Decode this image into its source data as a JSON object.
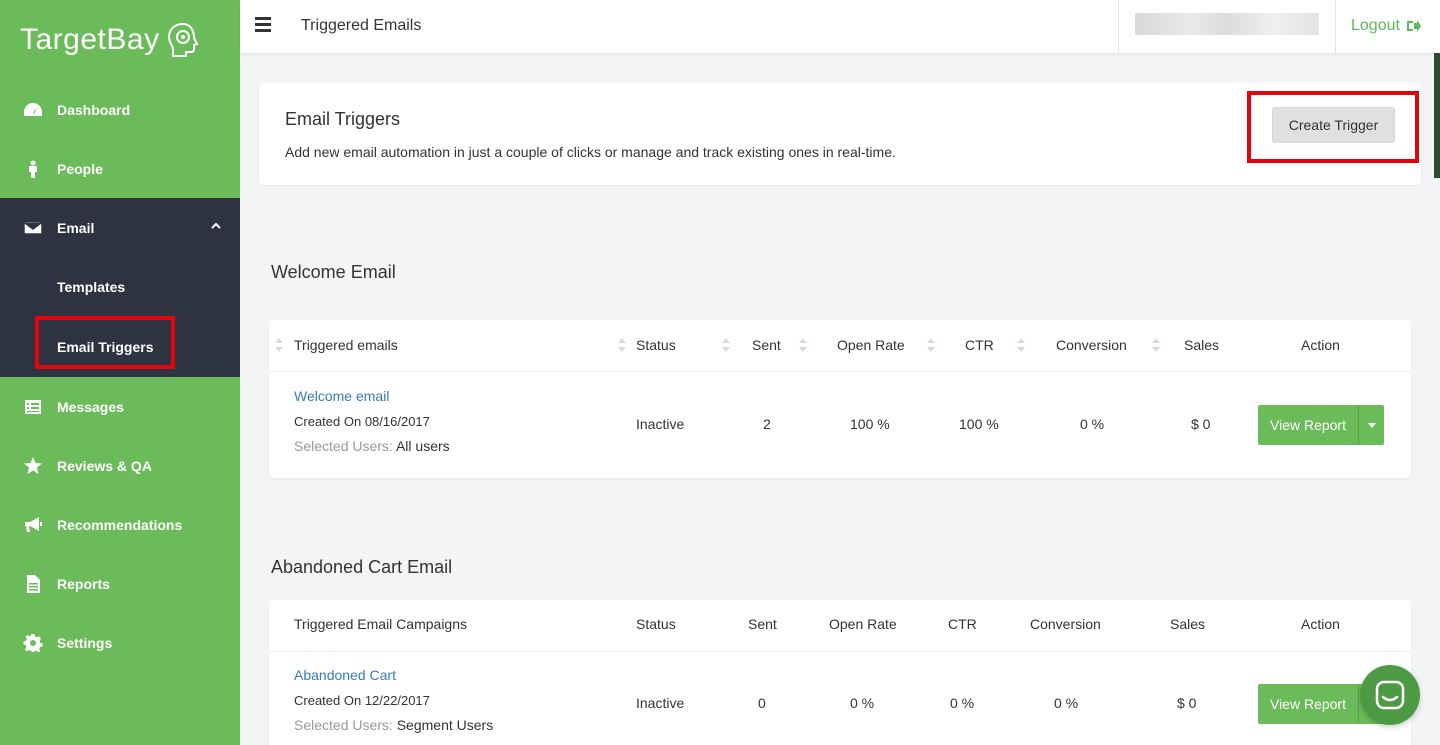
{
  "brand": {
    "name": "TargetBay"
  },
  "sidebar": {
    "items": [
      {
        "label": "Dashboard",
        "icon": "dashboard-icon"
      },
      {
        "label": "People",
        "icon": "person-icon"
      },
      {
        "label": "Email",
        "icon": "envelope-icon"
      },
      {
        "label": "Templates"
      },
      {
        "label": "Email Triggers"
      },
      {
        "label": "Messages",
        "icon": "messages-icon"
      },
      {
        "label": "Reviews & QA",
        "icon": "star-icon"
      },
      {
        "label": "Recommendations",
        "icon": "megaphone-icon"
      },
      {
        "label": "Reports",
        "icon": "document-icon"
      },
      {
        "label": "Settings",
        "icon": "gear-icon"
      }
    ]
  },
  "topbar": {
    "title": "Triggered Emails",
    "logout_label": "Logout"
  },
  "trigger_card": {
    "title": "Email Triggers",
    "description": "Add new email automation in just a couple of clicks or manage and track existing ones in real-time.",
    "create_label": "Create Trigger"
  },
  "welcome": {
    "section_title": "Welcome Email",
    "headers": [
      "Triggered emails",
      "Status",
      "Sent",
      "Open Rate",
      "CTR",
      "Conversion",
      "Sales",
      "Action"
    ],
    "row": {
      "name": "Welcome email",
      "created": "Created On 08/16/2017",
      "users_label": "Selected Users:",
      "users_value": "All users",
      "status": "Inactive",
      "sent": "2",
      "open_rate": "100 %",
      "ctr": "100 %",
      "conversion": "0 %",
      "sales": "$ 0",
      "action_label": "View Report"
    }
  },
  "abandoned": {
    "section_title": "Abandoned Cart Email",
    "headers": [
      "Triggered Email Campaigns",
      "Status",
      "Sent",
      "Open Rate",
      "CTR",
      "Conversion",
      "Sales",
      "Action"
    ],
    "row": {
      "name": "Abandoned Cart",
      "created": "Created On 12/22/2017",
      "users_label": "Selected Users:",
      "users_value": "Segment Users",
      "status": "Inactive",
      "sent": "0",
      "open_rate": "0 %",
      "ctr": "0 %",
      "conversion": "0 %",
      "sales": "$ 0",
      "action_label": "View Report"
    }
  },
  "colors": {
    "sidebar": "#6cbb5a",
    "sidebar_active": "#2d3340",
    "highlight": "#e5040b",
    "link": "#3a7ab9",
    "button_green": "#6cbb5a"
  }
}
